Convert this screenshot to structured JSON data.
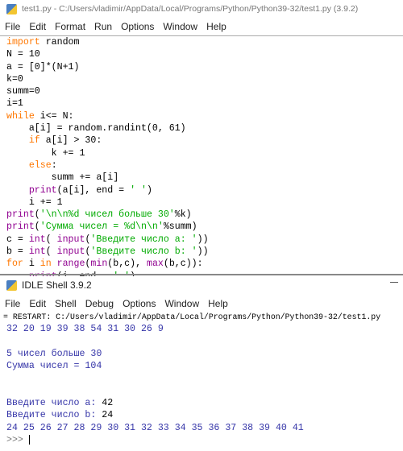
{
  "editor": {
    "title": "test1.py - C:/Users/vladimir/AppData/Local/Programs/Python/Python39-32/test1.py (3.9.2)",
    "menu": [
      "File",
      "Edit",
      "Format",
      "Run",
      "Options",
      "Window",
      "Help"
    ],
    "lines": [
      [
        [
          "k",
          "import"
        ],
        [
          "t",
          " random"
        ]
      ],
      [
        [
          "t",
          "N = 10"
        ]
      ],
      [
        [
          "t",
          "a = [0]*(N+1)"
        ]
      ],
      [
        [
          "t",
          "k=0"
        ]
      ],
      [
        [
          "t",
          "summ=0"
        ]
      ],
      [
        [
          "t",
          "i=1"
        ]
      ],
      [
        [
          "k",
          "while"
        ],
        [
          "t",
          " i<= N:"
        ]
      ],
      [
        [
          "t",
          "    a[i] = random.randint(0, 61)"
        ]
      ],
      [
        [
          "t",
          "    "
        ],
        [
          "k",
          "if"
        ],
        [
          "t",
          " a[i] > 30:"
        ]
      ],
      [
        [
          "t",
          "        k += 1"
        ]
      ],
      [
        [
          "t",
          "    "
        ],
        [
          "k",
          "else"
        ],
        [
          "t",
          ":"
        ]
      ],
      [
        [
          "t",
          "        summ += a[i]"
        ]
      ],
      [
        [
          "t",
          "    "
        ],
        [
          "b",
          "print"
        ],
        [
          "t",
          "(a[i], end = "
        ],
        [
          "s",
          "' '"
        ],
        [
          "t",
          ")"
        ]
      ],
      [
        [
          "t",
          "    i += 1"
        ]
      ],
      [
        [
          "b",
          "print"
        ],
        [
          "t",
          "("
        ],
        [
          "s",
          "'\\n\\n%d чисел больше 30'"
        ],
        [
          "t",
          "%k)"
        ]
      ],
      [
        [
          "b",
          "print"
        ],
        [
          "t",
          "("
        ],
        [
          "s",
          "'Сумма чисел = %d\\n\\n'"
        ],
        [
          "t",
          "%summ)"
        ]
      ],
      [
        [
          "t",
          "c = "
        ],
        [
          "b",
          "int"
        ],
        [
          "t",
          "( "
        ],
        [
          "b",
          "input"
        ],
        [
          "t",
          "("
        ],
        [
          "s",
          "'Введите число a: '"
        ],
        [
          "t",
          "))"
        ]
      ],
      [
        [
          "t",
          "b = "
        ],
        [
          "b",
          "int"
        ],
        [
          "t",
          "( "
        ],
        [
          "b",
          "input"
        ],
        [
          "t",
          "("
        ],
        [
          "s",
          "'Введите число b: '"
        ],
        [
          "t",
          "))"
        ]
      ],
      [
        [
          "k",
          "for"
        ],
        [
          "t",
          " i "
        ],
        [
          "k",
          "in"
        ],
        [
          "t",
          " "
        ],
        [
          "b",
          "range"
        ],
        [
          "t",
          "("
        ],
        [
          "b",
          "min"
        ],
        [
          "t",
          "(b,c), "
        ],
        [
          "b",
          "max"
        ],
        [
          "t",
          "(b,c)):"
        ]
      ],
      [
        [
          "t",
          "    "
        ],
        [
          "b",
          "print"
        ],
        [
          "t",
          "(i, end = "
        ],
        [
          "s",
          "' '"
        ],
        [
          "t",
          ")"
        ]
      ]
    ]
  },
  "shell": {
    "title": "IDLE Shell 3.9.2",
    "menu": [
      "File",
      "Edit",
      "Shell",
      "Debug",
      "Options",
      "Window",
      "Help"
    ],
    "lines": [
      [
        [
          "t",
          "= RESTART: C:/Users/vladimir/AppData/Local/Programs/Python/Python39-32/test1.py"
        ]
      ],
      [
        [
          "o",
          "32 20 19 39 38 54 31 30 26 9"
        ]
      ],
      [
        [
          "o",
          ""
        ]
      ],
      [
        [
          "o",
          "5 чисел больше 30"
        ]
      ],
      [
        [
          "o",
          "Сумма чисел = 104"
        ]
      ],
      [
        [
          "o",
          ""
        ]
      ],
      [
        [
          "o",
          ""
        ]
      ],
      [
        [
          "o",
          "Введите число a: "
        ],
        [
          "t",
          "42"
        ]
      ],
      [
        [
          "o",
          "Введите число b: "
        ],
        [
          "t",
          "24"
        ]
      ],
      [
        [
          "o",
          "24 25 26 27 28 29 30 31 32 33 34 35 36 37 38 39 40 41"
        ]
      ]
    ],
    "prompt": ">>> "
  },
  "colors": {
    "keyword": "#ff7700",
    "builtin": "#900090",
    "string": "#00aa00",
    "output": "#3535a8"
  }
}
